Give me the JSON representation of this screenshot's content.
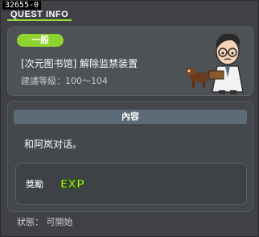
{
  "window": {
    "quest_id": "32655-0",
    "title": "QUEST INFO"
  },
  "header": {
    "badge_label": "一般",
    "quest_name": "[次元图书馆] 解除监禁装置",
    "level_requirement": "建議等級：100～104",
    "npc_icon": "scientist-npc-with-robot-dog-icon"
  },
  "content": {
    "section_label": "內容",
    "description": "和阿岚对话。"
  },
  "reward": {
    "label": "獎勵",
    "item_icon": "exp-icon",
    "item_text": "EXP"
  },
  "status": {
    "text": "狀態： 可開始"
  },
  "colors": {
    "accent_green": "#8fd42e",
    "panel_bg": "#3f4146",
    "section_bar": "#5c6b75"
  }
}
